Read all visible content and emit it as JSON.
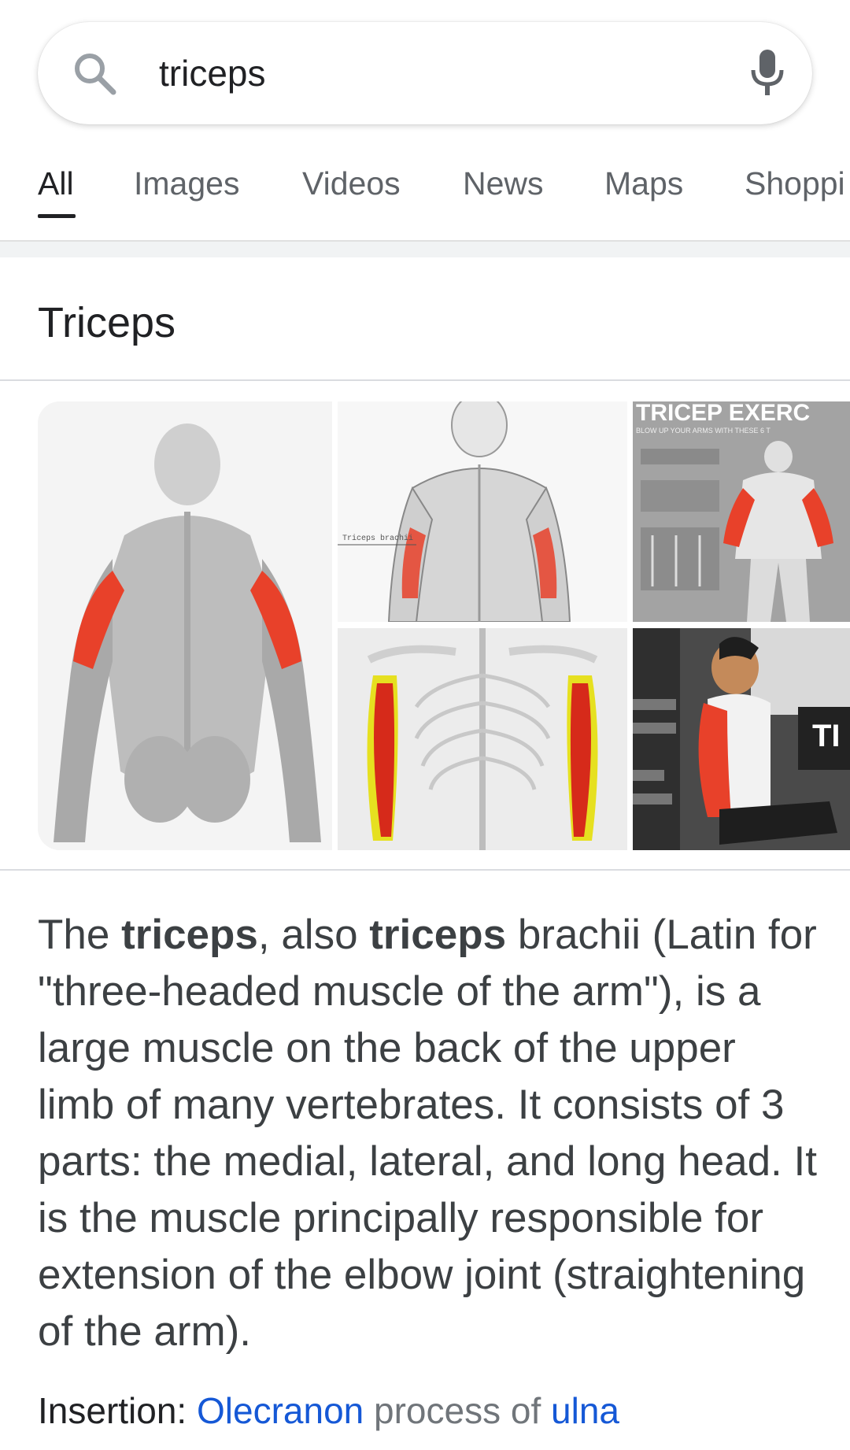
{
  "search": {
    "query": "triceps",
    "search_icon": "search-icon",
    "mic_icon": "microphone-icon"
  },
  "tabs": [
    {
      "label": "All",
      "active": true
    },
    {
      "label": "Images"
    },
    {
      "label": "Videos"
    },
    {
      "label": "News"
    },
    {
      "label": "Maps"
    },
    {
      "label": "Shoppi"
    }
  ],
  "knowledge_panel": {
    "title": "Triceps",
    "image_texts": {
      "anatomy_label": "Triceps brachii",
      "exercise_heading": "TRICEP EXERC",
      "exercise_sub": "BLOW UP YOUR ARMS WITH THESE 6 T",
      "gym_banner": "TI"
    },
    "description": {
      "p1": "The ",
      "b1": "triceps",
      "p2": ", also ",
      "b2": "triceps",
      "p3": " brachii (Latin for \"three-headed muscle of the arm\"), is a large muscle on the back of the upper limb of many vertebrates. It consists of 3 parts: the medial, lateral, and long head. It is the muscle principally responsible for extension of the elbow joint (straightening of the arm)."
    },
    "insertion": {
      "label": "Insertion: ",
      "link1": "Olecranon",
      "middle": " process of ",
      "link2": "ulna"
    }
  },
  "colors": {
    "muscle_red": "#e8412a",
    "link_blue": "#1558d6",
    "text_dark": "#202124",
    "text_gray": "#5f6368"
  }
}
